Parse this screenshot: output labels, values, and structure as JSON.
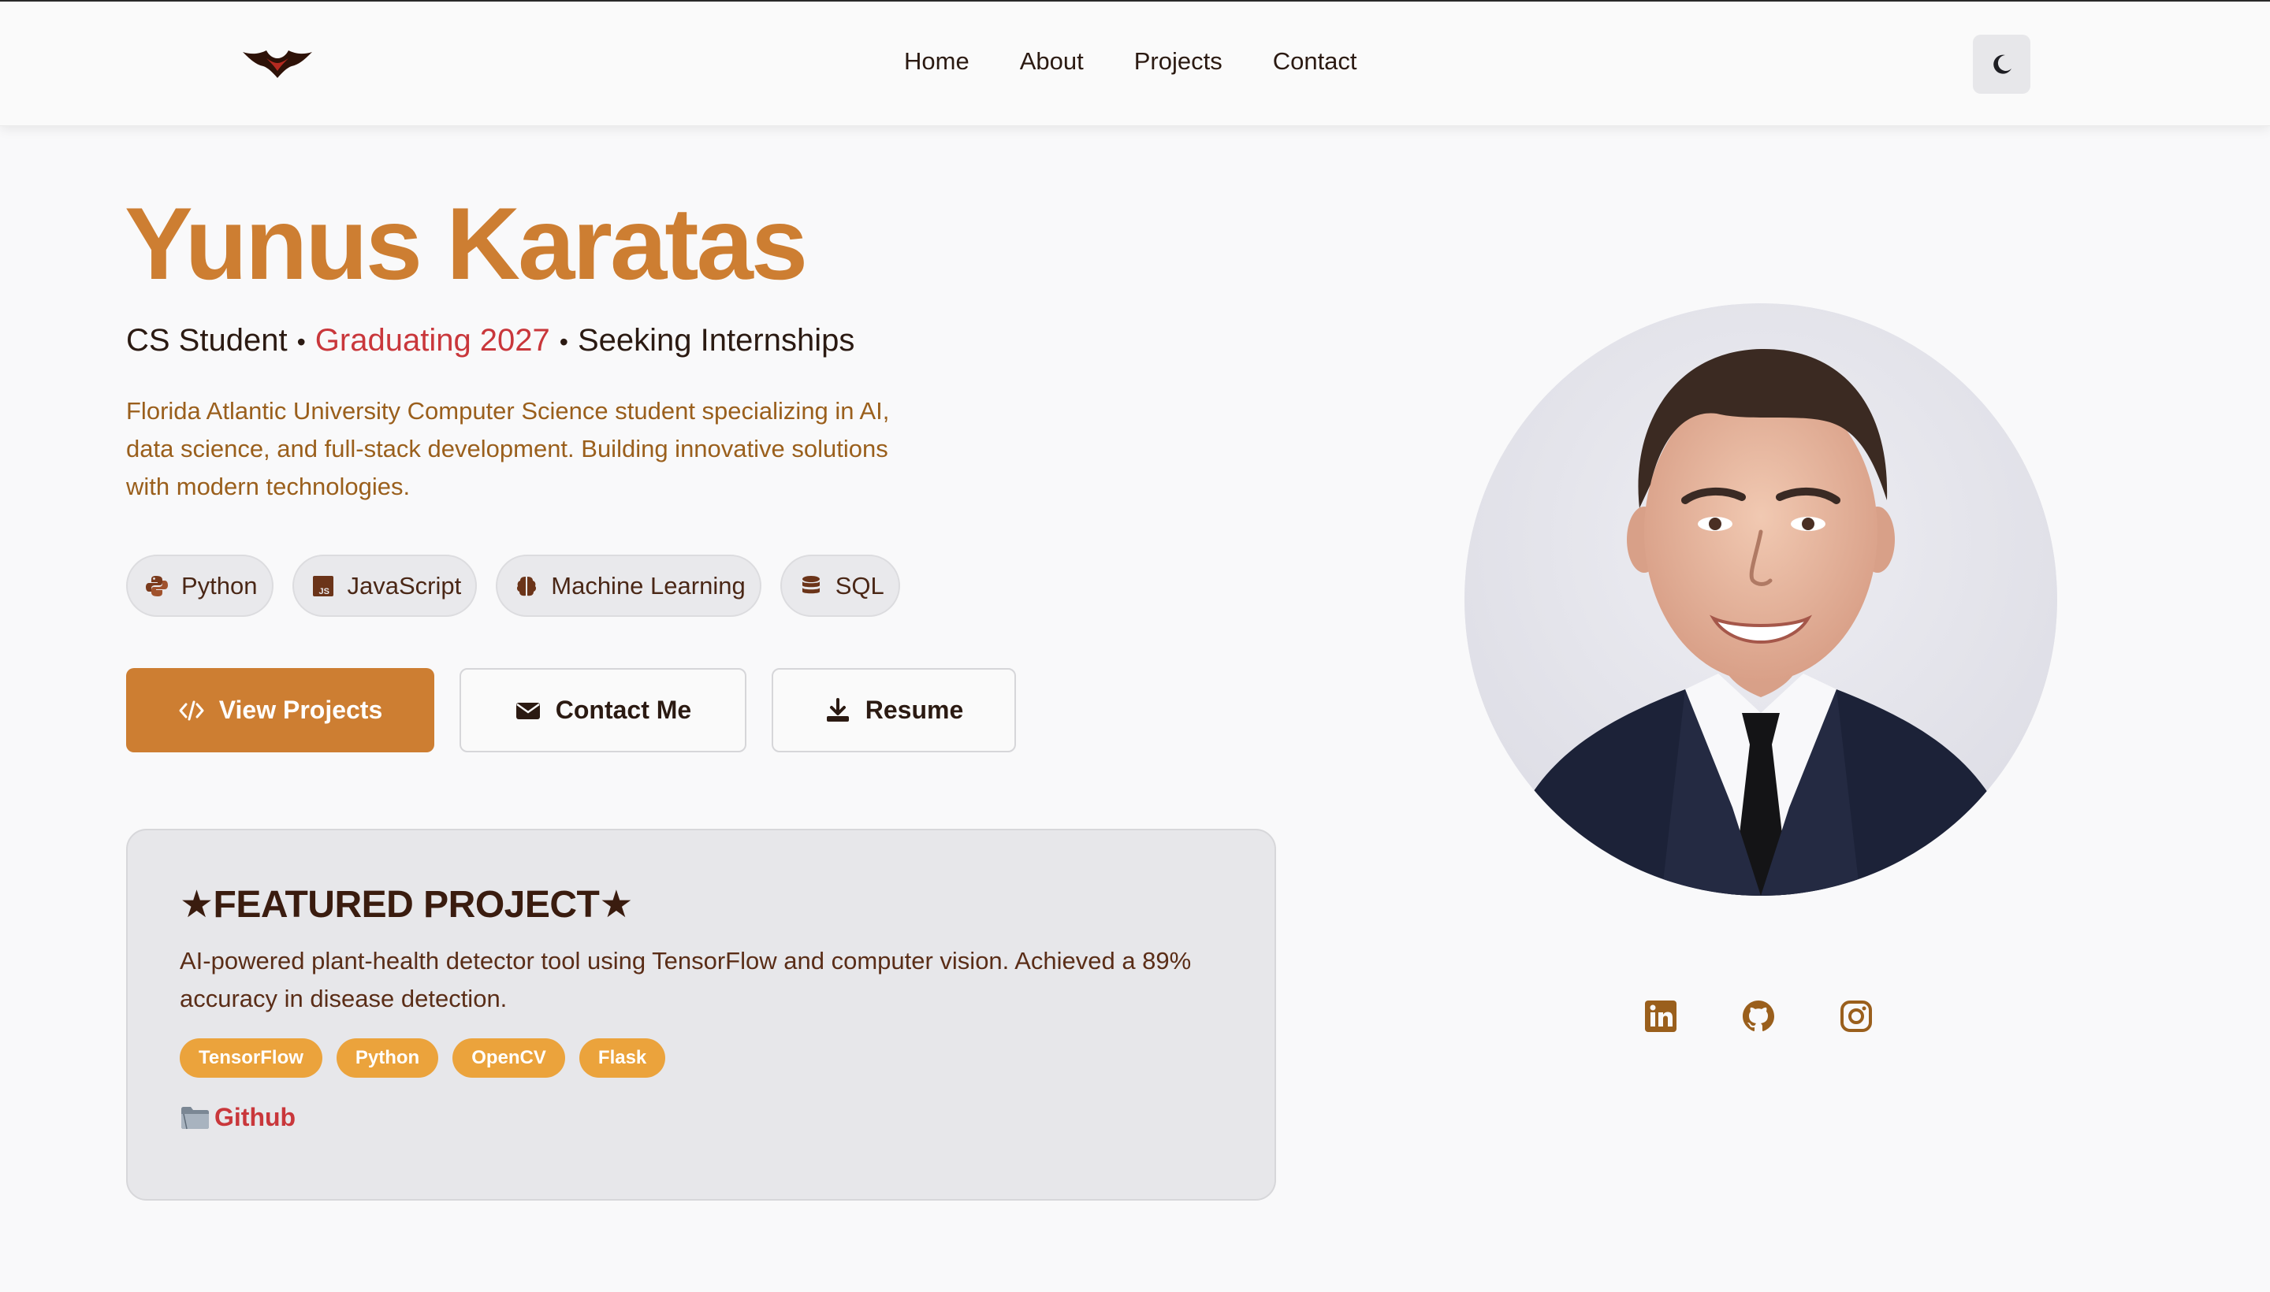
{
  "nav": {
    "logo_icon": "bat-logo-icon",
    "links": [
      "Home",
      "About",
      "Projects",
      "Contact"
    ],
    "theme_icon": "moon-icon"
  },
  "hero": {
    "name": "Yunus Karatas",
    "tagline": {
      "part1": "CS Student",
      "separator": "•",
      "part2": "Graduating 2027",
      "part3": "Seeking Internships"
    },
    "bio": "Florida Atlantic University Computer Science student specializing in AI, data science, and full-stack development. Building innovative solutions with modern technologies.",
    "skills": [
      {
        "label": "Python",
        "icon": "python-icon"
      },
      {
        "label": "JavaScript",
        "icon": "js-icon"
      },
      {
        "label": "Machine Learning",
        "icon": "brain-icon"
      },
      {
        "label": "SQL",
        "icon": "database-icon"
      }
    ],
    "buttons": {
      "view_projects": "View Projects",
      "contact_me": "Contact Me",
      "resume": "Resume"
    }
  },
  "featured": {
    "title": "★FEATURED PROJECT★",
    "description": "AI-powered plant-health detector tool using TensorFlow and computer vision. Achieved a 89% accuracy in disease detection.",
    "tags": [
      "TensorFlow",
      "Python",
      "OpenCV",
      "Flask"
    ],
    "link_label": "Github",
    "link_icon": "folder-icon"
  },
  "socials": [
    "linkedin-icon",
    "github-icon",
    "instagram-icon"
  ],
  "colors": {
    "accent": "#cd7e32",
    "highlight": "#c9373b",
    "tag": "#eba33c",
    "text_dark": "#2b1a12",
    "bio_text": "#9a5f1c",
    "social_icon": "#9a5f1c"
  }
}
